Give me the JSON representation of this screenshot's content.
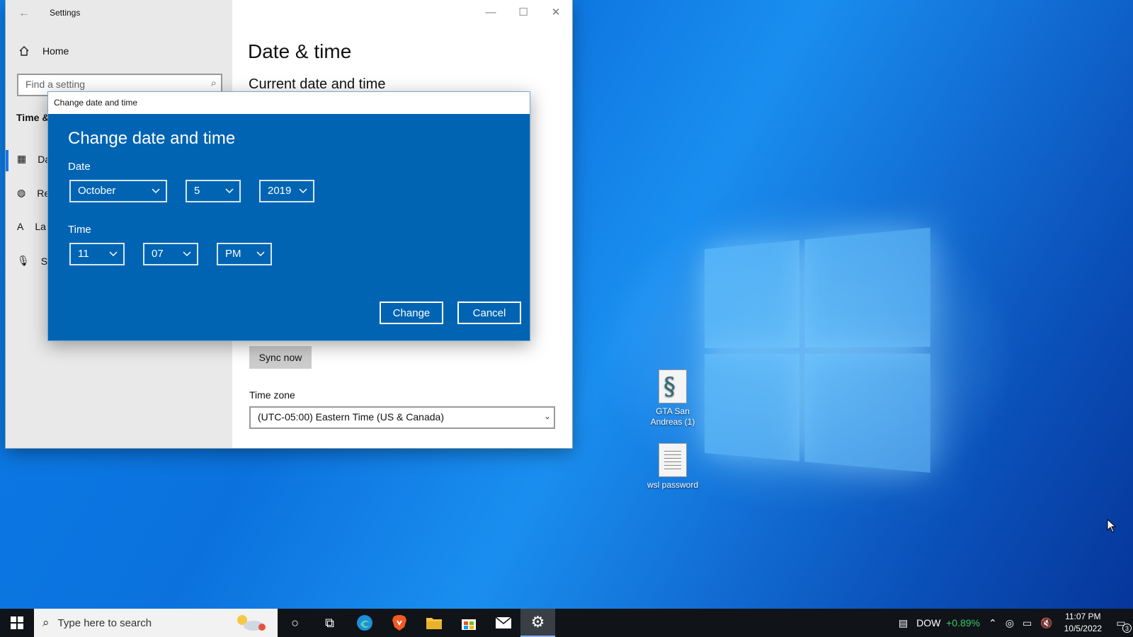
{
  "settings_window": {
    "title": "Settings",
    "home_label": "Home",
    "search_placeholder": "Find a setting",
    "section_label": "Time &",
    "nav_items": [
      "Da",
      "Re",
      "La",
      "Sp"
    ],
    "page_title": "Date & time",
    "current_heading": "Current date and time",
    "sync_button": "Sync now",
    "timezone_label": "Time zone",
    "timezone_value": "(UTC-05:00) Eastern Time (US & Canada)"
  },
  "dialog": {
    "window_title": "Change date and time",
    "heading": "Change date and time",
    "date_label": "Date",
    "month": "October",
    "day": "5",
    "year": "2019",
    "time_label": "Time",
    "hour": "11",
    "minute": "07",
    "ampm": "PM",
    "change_button": "Change",
    "cancel_button": "Cancel"
  },
  "desktop_icons": [
    {
      "label_line1": "GTA San",
      "label_line2": "Andreas (1)",
      "icon": "script-file-icon"
    },
    {
      "label_line1": "wsl password",
      "label_line2": "",
      "icon": "text-file-icon"
    }
  ],
  "taskbar": {
    "search_placeholder": "Type here to search",
    "stock_ticker": "DOW",
    "stock_change": "+0.89%",
    "time": "11:07 PM",
    "date": "10/5/2022",
    "notification_count": "3"
  },
  "colors": {
    "dialog_bg": "#0064b3",
    "accent": "#1a73e8",
    "stock_up": "#39c76b"
  }
}
